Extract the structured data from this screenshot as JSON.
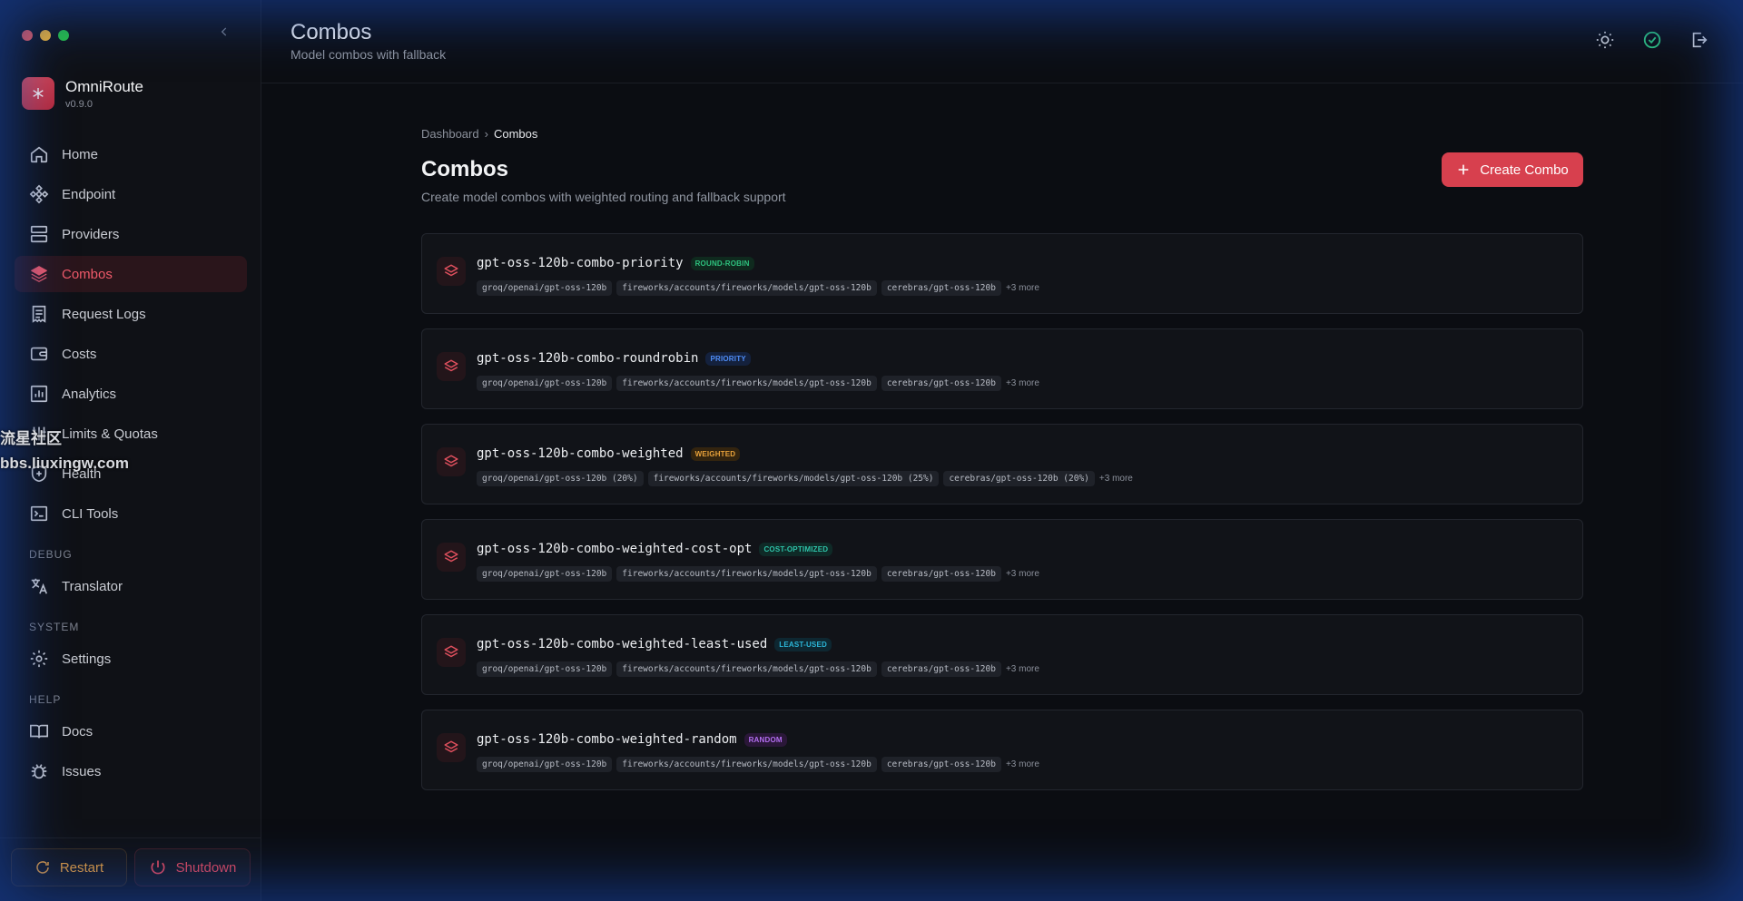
{
  "window": {
    "controls": [
      "close",
      "minimize",
      "maximize"
    ]
  },
  "brand": {
    "name": "OmniRoute",
    "version": "v0.9.0"
  },
  "sidebar": {
    "items": [
      {
        "label": "Home",
        "icon": "home-icon"
      },
      {
        "label": "Endpoint",
        "icon": "endpoint-icon"
      },
      {
        "label": "Providers",
        "icon": "server-icon"
      },
      {
        "label": "Combos",
        "icon": "layers-icon",
        "active": true
      },
      {
        "label": "Request Logs",
        "icon": "receipt-icon"
      },
      {
        "label": "Costs",
        "icon": "wallet-icon"
      },
      {
        "label": "Analytics",
        "icon": "chart-icon"
      },
      {
        "label": "Limits & Quotas",
        "icon": "sliders-icon"
      },
      {
        "label": "Health",
        "icon": "shield-icon"
      },
      {
        "label": "CLI Tools",
        "icon": "terminal-icon"
      }
    ],
    "sections": {
      "debug": {
        "title": "DEBUG",
        "items": [
          {
            "label": "Translator",
            "icon": "translate-icon"
          }
        ]
      },
      "system": {
        "title": "SYSTEM",
        "items": [
          {
            "label": "Settings",
            "icon": "gear-icon"
          }
        ]
      },
      "help": {
        "title": "HELP",
        "items": [
          {
            "label": "Docs",
            "icon": "book-icon"
          },
          {
            "label": "Issues",
            "icon": "bug-icon"
          }
        ]
      }
    },
    "footer": {
      "restart_label": "Restart",
      "shutdown_label": "Shutdown"
    }
  },
  "watermark": {
    "line1": "流星社区",
    "line2": "bbs.liuxingw.com"
  },
  "header": {
    "title": "Combos",
    "subtitle": "Model combos with fallback"
  },
  "breadcrumb": {
    "root": "Dashboard",
    "separator": "›",
    "current": "Combos"
  },
  "page": {
    "title": "Combos",
    "description": "Create model combos with weighted routing and fallback support",
    "create_label": "Create Combo"
  },
  "colors": {
    "accent": "#d7404e",
    "round_robin": "#2ec27e",
    "priority": "#4f8df7",
    "weighted": "#e9a23b",
    "cost_optimized": "#2ec2a8",
    "least_used": "#2bb6d8",
    "random": "#b36ef0"
  },
  "combos": [
    {
      "name": "gpt-oss-120b-combo-priority",
      "strategy": "ROUND-ROBIN",
      "models": [
        "groq/openai/gpt-oss-120b",
        "fireworks/accounts/fireworks/models/gpt-oss-120b",
        "cerebras/gpt-oss-120b"
      ],
      "more": "+3 more"
    },
    {
      "name": "gpt-oss-120b-combo-roundrobin",
      "strategy": "PRIORITY",
      "models": [
        "groq/openai/gpt-oss-120b",
        "fireworks/accounts/fireworks/models/gpt-oss-120b",
        "cerebras/gpt-oss-120b"
      ],
      "more": "+3 more"
    },
    {
      "name": "gpt-oss-120b-combo-weighted",
      "strategy": "WEIGHTED",
      "models": [
        "groq/openai/gpt-oss-120b (20%)",
        "fireworks/accounts/fireworks/models/gpt-oss-120b (25%)",
        "cerebras/gpt-oss-120b (20%)"
      ],
      "more": "+3 more"
    },
    {
      "name": "gpt-oss-120b-combo-weighted-cost-opt",
      "strategy": "COST-OPTIMIZED",
      "models": [
        "groq/openai/gpt-oss-120b",
        "fireworks/accounts/fireworks/models/gpt-oss-120b",
        "cerebras/gpt-oss-120b"
      ],
      "more": "+3 more"
    },
    {
      "name": "gpt-oss-120b-combo-weighted-least-used",
      "strategy": "LEAST-USED",
      "models": [
        "groq/openai/gpt-oss-120b",
        "fireworks/accounts/fireworks/models/gpt-oss-120b",
        "cerebras/gpt-oss-120b"
      ],
      "more": "+3 more"
    },
    {
      "name": "gpt-oss-120b-combo-weighted-random",
      "strategy": "RANDOM",
      "models": [
        "groq/openai/gpt-oss-120b",
        "fireworks/accounts/fireworks/models/gpt-oss-120b",
        "cerebras/gpt-oss-120b"
      ],
      "more": "+3 more"
    }
  ]
}
